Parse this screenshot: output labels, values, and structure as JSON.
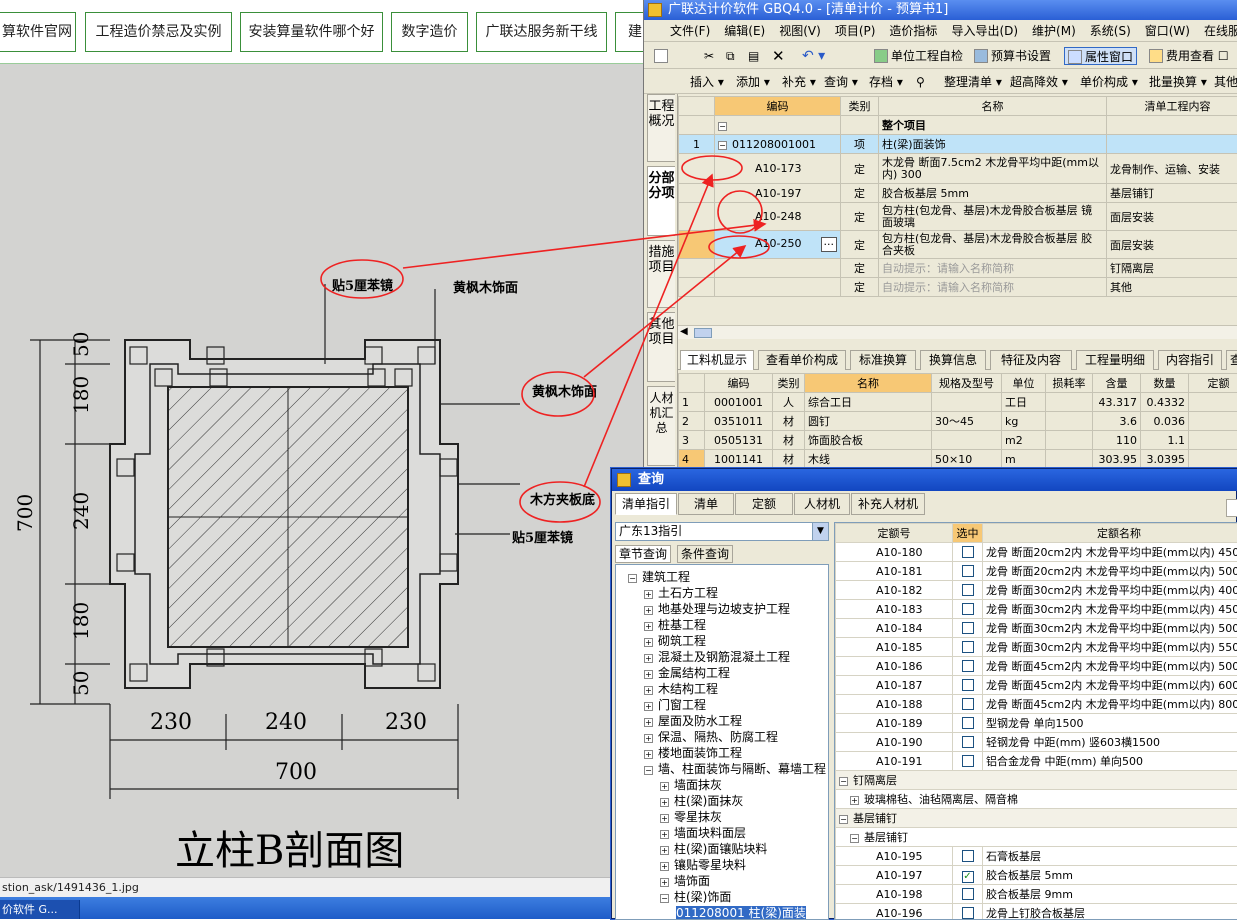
{
  "webnav": {
    "items": [
      "算软件官网",
      "工程造价禁忌及实例",
      "安装算量软件哪个好",
      "数字造价",
      "广联达服务新干线",
      "建"
    ]
  },
  "drawing": {
    "labels": {
      "tie1": "贴5厘苯镜",
      "wood_face_top": "黄枫木饰面",
      "wood_face_right": "黄枫木饰面",
      "board_base": "木方夹板底",
      "tie2": "贴5厘苯镜"
    },
    "dims_v": [
      "50",
      "180",
      "240",
      "180",
      "50"
    ],
    "dims_v_total": "700",
    "dims_h": [
      "230",
      "240",
      "230"
    ],
    "dims_h_total": "700",
    "title": "立柱B剖面图"
  },
  "statusbar": {
    "url": "stion_ask/1491436_1.jpg"
  },
  "taskbar": {
    "item": "价软件 G..."
  },
  "gbq": {
    "title": "广联达计价软件 GBQ4.0 - [清单计价 - 预算书1]",
    "menu": [
      "文件(F)",
      "编辑(E)",
      "视图(V)",
      "项目(P)",
      "造价指标",
      "导入导出(D)",
      "维护(M)",
      "系统(S)",
      "窗口(W)",
      "在线服务(L)"
    ],
    "toolbar1": {
      "check": "单位工程自检",
      "setting": "预算书设置",
      "attr": "属性窗口",
      "fee": "费用查看"
    },
    "toolbar2": [
      "插入 ▾",
      "添加 ▾",
      "补充 ▾",
      "查询 ▾",
      "存档 ▾",
      "整理清单 ▾",
      "超高降效 ▾",
      "单价构成 ▾",
      "批量换算 ▾",
      "其他"
    ],
    "vtabs": [
      "工程概况",
      "分部分项",
      "措施项目",
      "其他项目",
      "人材机汇总"
    ],
    "top_headers": [
      "编码",
      "类别",
      "名称",
      "清单工程内容"
    ],
    "top_rows": [
      {
        "num": "",
        "code": "",
        "type": "",
        "name": "整个项目",
        "content": ""
      },
      {
        "num": "1",
        "code": "011208001001",
        "type": "项",
        "name": "柱(梁)面装饰",
        "content": ""
      },
      {
        "num": "",
        "code": "A10-173",
        "type": "定",
        "name": "木龙骨 断面7.5cm2 木龙骨平均中距(mm以内) 300",
        "content": "龙骨制作、运输、安装"
      },
      {
        "num": "",
        "code": "A10-197",
        "type": "定",
        "name": "胶合板基层 5mm",
        "content": "基层铺钉"
      },
      {
        "num": "",
        "code": "A10-248",
        "type": "定",
        "name": "包方柱(包龙骨、基层)木龙骨胶合板基层 镜面玻璃",
        "content": "面层安装"
      },
      {
        "num": "",
        "code": "A10-250",
        "type": "定",
        "name": "包方柱(包龙骨、基层)木龙骨胶合板基层 胶合夹板",
        "content": "面层安装"
      },
      {
        "num": "",
        "code": "",
        "type": "定",
        "name": "自动提示：请输入名称简称",
        "content": "钉隔离层"
      },
      {
        "num": "",
        "code": "",
        "type": "定",
        "name": "自动提示：请输入名称简称",
        "content": "其他"
      }
    ],
    "mid_tabs": [
      "工料机显示",
      "查看单价构成",
      "标准换算",
      "换算信息",
      "特征及内容",
      "工程量明细",
      "内容指引",
      "查"
    ],
    "bot_headers": [
      "编码",
      "类别",
      "名称",
      "规格及型号",
      "单位",
      "损耗率",
      "含量",
      "数量",
      "定额"
    ],
    "bot_rows": [
      {
        "num": "1",
        "code": "0001001",
        "type": "人",
        "name": "综合工日",
        "spec": "",
        "unit": "工日",
        "loss": "",
        "qty": "43.317",
        "amount": "0.4332"
      },
      {
        "num": "2",
        "code": "0351011",
        "type": "材",
        "name": "圆钉",
        "spec": "30～45",
        "unit": "kg",
        "loss": "",
        "qty": "3.6",
        "amount": "0.036"
      },
      {
        "num": "3",
        "code": "0505131",
        "type": "材",
        "name": "饰面胶合板",
        "spec": "",
        "unit": "m2",
        "loss": "",
        "qty": "110",
        "amount": "1.1"
      },
      {
        "num": "4",
        "code": "1001141",
        "type": "材",
        "name": "木线",
        "spec": "50×10",
        "unit": "m",
        "loss": "",
        "qty": "303.95",
        "amount": "3.0395"
      }
    ]
  },
  "dialog": {
    "title": "查询",
    "tabs": [
      "清单指引",
      "清单",
      "定额",
      "人材机",
      "补充人材机"
    ],
    "guide": "广东13指引",
    "subtabs": [
      "章节查询",
      "条件查询"
    ],
    "tree": [
      {
        "label": "建筑工程",
        "level": 0,
        "box": "−"
      },
      {
        "label": "土石方工程",
        "level": 1,
        "box": "+"
      },
      {
        "label": "地基处理与边坡支护工程",
        "level": 1,
        "box": "+"
      },
      {
        "label": "桩基工程",
        "level": 1,
        "box": "+"
      },
      {
        "label": "砌筑工程",
        "level": 1,
        "box": "+"
      },
      {
        "label": "混凝土及钢筋混凝土工程",
        "level": 1,
        "box": "+"
      },
      {
        "label": "金属结构工程",
        "level": 1,
        "box": "+"
      },
      {
        "label": "木结构工程",
        "level": 1,
        "box": "+"
      },
      {
        "label": "门窗工程",
        "level": 1,
        "box": "+"
      },
      {
        "label": "屋面及防水工程",
        "level": 1,
        "box": "+"
      },
      {
        "label": "保温、隔热、防腐工程",
        "level": 1,
        "box": "+"
      },
      {
        "label": "楼地面装饰工程",
        "level": 1,
        "box": "+"
      },
      {
        "label": "墙、柱面装饰与隔断、幕墙工程",
        "level": 1,
        "box": "−"
      },
      {
        "label": "墙面抹灰",
        "level": 2,
        "box": "+"
      },
      {
        "label": "柱(梁)面抹灰",
        "level": 2,
        "box": "+"
      },
      {
        "label": "零星抹灰",
        "level": 2,
        "box": "+"
      },
      {
        "label": "墙面块料面层",
        "level": 2,
        "box": "+"
      },
      {
        "label": "柱(梁)面镶贴块料",
        "level": 2,
        "box": "+"
      },
      {
        "label": "镶贴零星块料",
        "level": 2,
        "box": "+"
      },
      {
        "label": "墙饰面",
        "level": 2,
        "box": "+"
      },
      {
        "label": "柱(梁)饰面",
        "level": 2,
        "box": "−"
      },
      {
        "label": "011208001  柱(梁)面装",
        "level": 3,
        "box": ""
      }
    ],
    "grid_headers": [
      "定额号",
      "选中",
      "定额名称"
    ],
    "grid_rows": [
      {
        "code": "A10-180",
        "checked": "",
        "name": "龙骨 断面20cm2内 木龙骨平均中距(mm以内) 450"
      },
      {
        "code": "A10-181",
        "checked": "",
        "name": "龙骨 断面20cm2内 木龙骨平均中距(mm以内) 500"
      },
      {
        "code": "A10-182",
        "checked": "",
        "name": "龙骨 断面30cm2内 木龙骨平均中距(mm以内) 400"
      },
      {
        "code": "A10-183",
        "checked": "",
        "name": "龙骨 断面30cm2内 木龙骨平均中距(mm以内) 450"
      },
      {
        "code": "A10-184",
        "checked": "",
        "name": "龙骨 断面30cm2内 木龙骨平均中距(mm以内) 500"
      },
      {
        "code": "A10-185",
        "checked": "",
        "name": "龙骨 断面30cm2内 木龙骨平均中距(mm以内) 550"
      },
      {
        "code": "A10-186",
        "checked": "",
        "name": "龙骨 断面45cm2内 木龙骨平均中距(mm以内) 500"
      },
      {
        "code": "A10-187",
        "checked": "",
        "name": "龙骨 断面45cm2内 木龙骨平均中距(mm以内) 600"
      },
      {
        "code": "A10-188",
        "checked": "",
        "name": "龙骨 断面45cm2内 木龙骨平均中距(mm以内) 800"
      },
      {
        "code": "A10-189",
        "checked": "",
        "name": "型钢龙骨 单向1500"
      },
      {
        "code": "A10-190",
        "checked": "",
        "name": "轻钢龙骨 中距(mm) 竖603横1500"
      },
      {
        "code": "A10-191",
        "checked": "",
        "name": "铝合金龙骨 中距(mm) 单向500"
      }
    ],
    "group1": "钉隔离层",
    "group1_child": "玻璃棉毡、油毡隔离层、隔音棉",
    "group2": "基层铺钉",
    "group2_child": "基层铺钉",
    "grid_rows2": [
      {
        "code": "A10-195",
        "checked": "",
        "name": "石膏板基层"
      },
      {
        "code": "A10-197",
        "checked": "✓",
        "name": "胶合板基层 5mm"
      },
      {
        "code": "A10-198",
        "checked": "",
        "name": "胶合板基层 9mm"
      },
      {
        "code": "A10-196",
        "checked": "",
        "name": "龙骨上钉胶合板基层"
      }
    ]
  }
}
